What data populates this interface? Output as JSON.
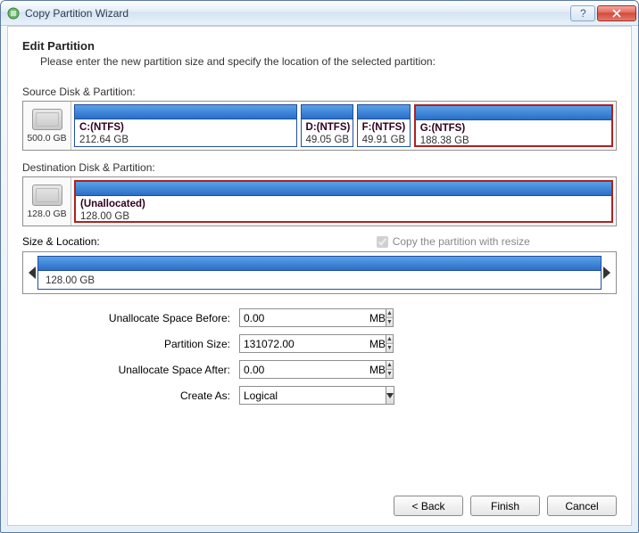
{
  "window": {
    "title": "Copy Partition Wizard"
  },
  "header": {
    "title": "Edit Partition",
    "subtitle": "Please enter the new partition size and specify the location of the selected partition:"
  },
  "source": {
    "label": "Source Disk & Partition:",
    "disk_capacity": "500.0 GB",
    "partitions": [
      {
        "name": "C:(NTFS)",
        "size": "212.64 GB",
        "flex": 212.64,
        "selected": false
      },
      {
        "name": "D:(NTFS)",
        "size": "49.05 GB",
        "flex": 49.05,
        "selected": false
      },
      {
        "name": "F:(NTFS)",
        "size": "49.91 GB",
        "flex": 49.91,
        "selected": false
      },
      {
        "name": "G:(NTFS)",
        "size": "188.38 GB",
        "flex": 188.38,
        "selected": true
      }
    ]
  },
  "dest": {
    "label": "Destination Disk & Partition:",
    "disk_capacity": "128.0 GB",
    "partitions": [
      {
        "name": "(Unallocated)",
        "size": "128.00 GB",
        "flex": 128,
        "selected": true
      }
    ]
  },
  "sizeloc": {
    "label": "Size & Location:",
    "checkbox": "Copy the partition with resize",
    "checkbox_checked": true,
    "bar_size": "128.00 GB"
  },
  "form": {
    "unalloc_before_label": "Unallocate Space Before:",
    "unalloc_before_value": "0.00",
    "partition_size_label": "Partition Size:",
    "partition_size_value": "131072.00",
    "unalloc_after_label": "Unallocate Space After:",
    "unalloc_after_value": "0.00",
    "unit": "MB",
    "create_as_label": "Create As:",
    "create_as_value": "Logical"
  },
  "buttons": {
    "back": "< Back",
    "finish": "Finish",
    "cancel": "Cancel"
  }
}
